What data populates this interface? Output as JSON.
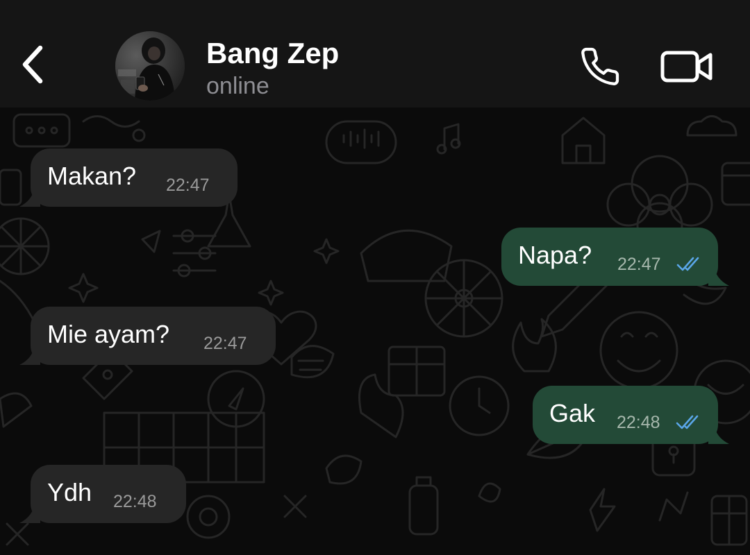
{
  "header": {
    "back_icon": "chevron-left-icon",
    "contact_name": "Bang Zep",
    "status": "online",
    "call_icon": "phone-icon",
    "video_icon": "video-camera-icon"
  },
  "messages": [
    {
      "direction": "incoming",
      "text": "Makan?",
      "time": "22:47"
    },
    {
      "direction": "outgoing",
      "text": "Napa?",
      "time": "22:47",
      "status": "read"
    },
    {
      "direction": "incoming",
      "text": "Mie ayam?",
      "time": "22:47"
    },
    {
      "direction": "outgoing",
      "text": "Gak",
      "time": "22:48",
      "status": "read"
    },
    {
      "direction": "incoming",
      "text": "Ydh",
      "time": "22:48"
    }
  ],
  "colors": {
    "header_bg": "#151515",
    "chat_bg": "#0b0b0b",
    "incoming_bubble": "#262626",
    "outgoing_bubble": "#234a37",
    "read_ticks": "#5aa6e8",
    "status_text": "#8e8e93"
  }
}
